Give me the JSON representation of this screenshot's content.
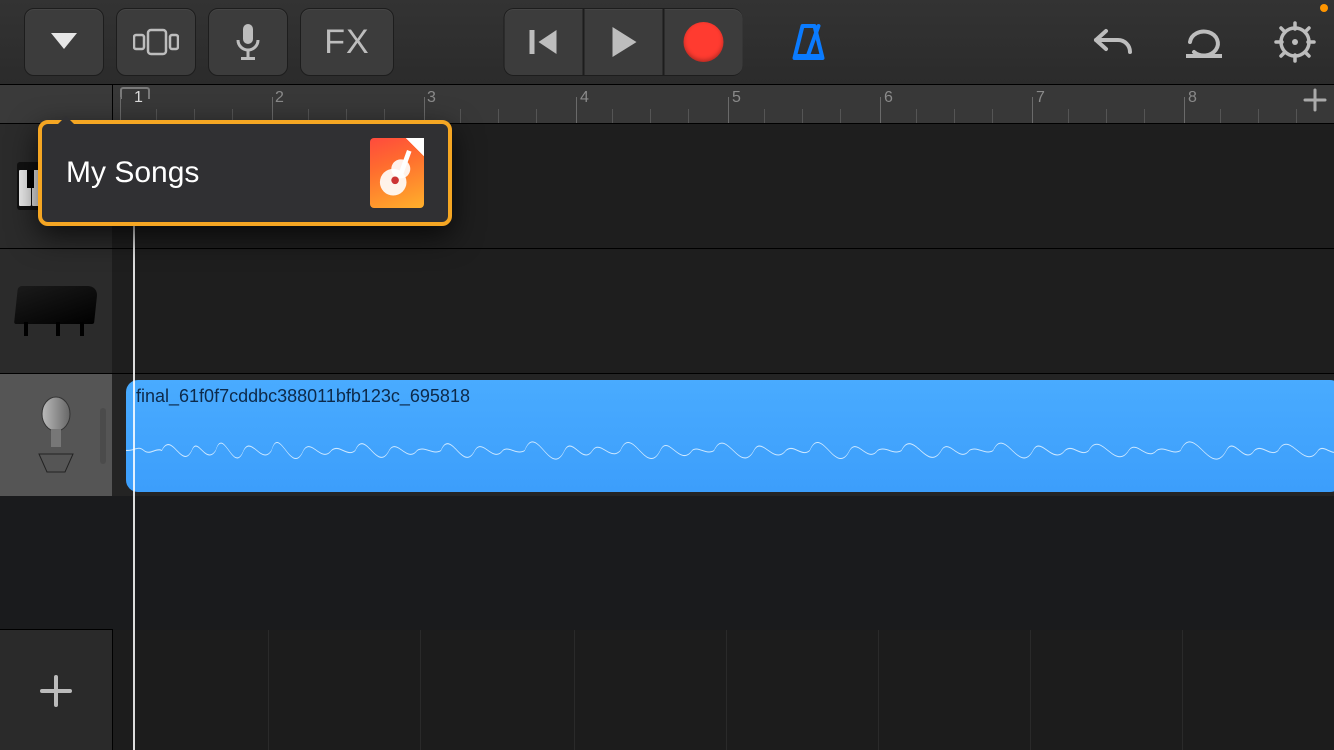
{
  "toolbar": {
    "fx_label": "FX"
  },
  "ruler": {
    "bar_numbers": [
      "1",
      "2",
      "3",
      "4",
      "5",
      "6",
      "7",
      "8"
    ]
  },
  "popover": {
    "title": "My Songs"
  },
  "tracks": [
    {
      "instrument": "keyboard"
    },
    {
      "instrument": "grand-piano"
    },
    {
      "instrument": "microphone",
      "region": {
        "name": "final_61f0f7cddbc388011bfb123c_695818"
      }
    }
  ],
  "colors": {
    "record": "#ff3b30",
    "metronome": "#0a7bff",
    "highlight_border": "#f5a623",
    "region": "#3c9efb"
  }
}
